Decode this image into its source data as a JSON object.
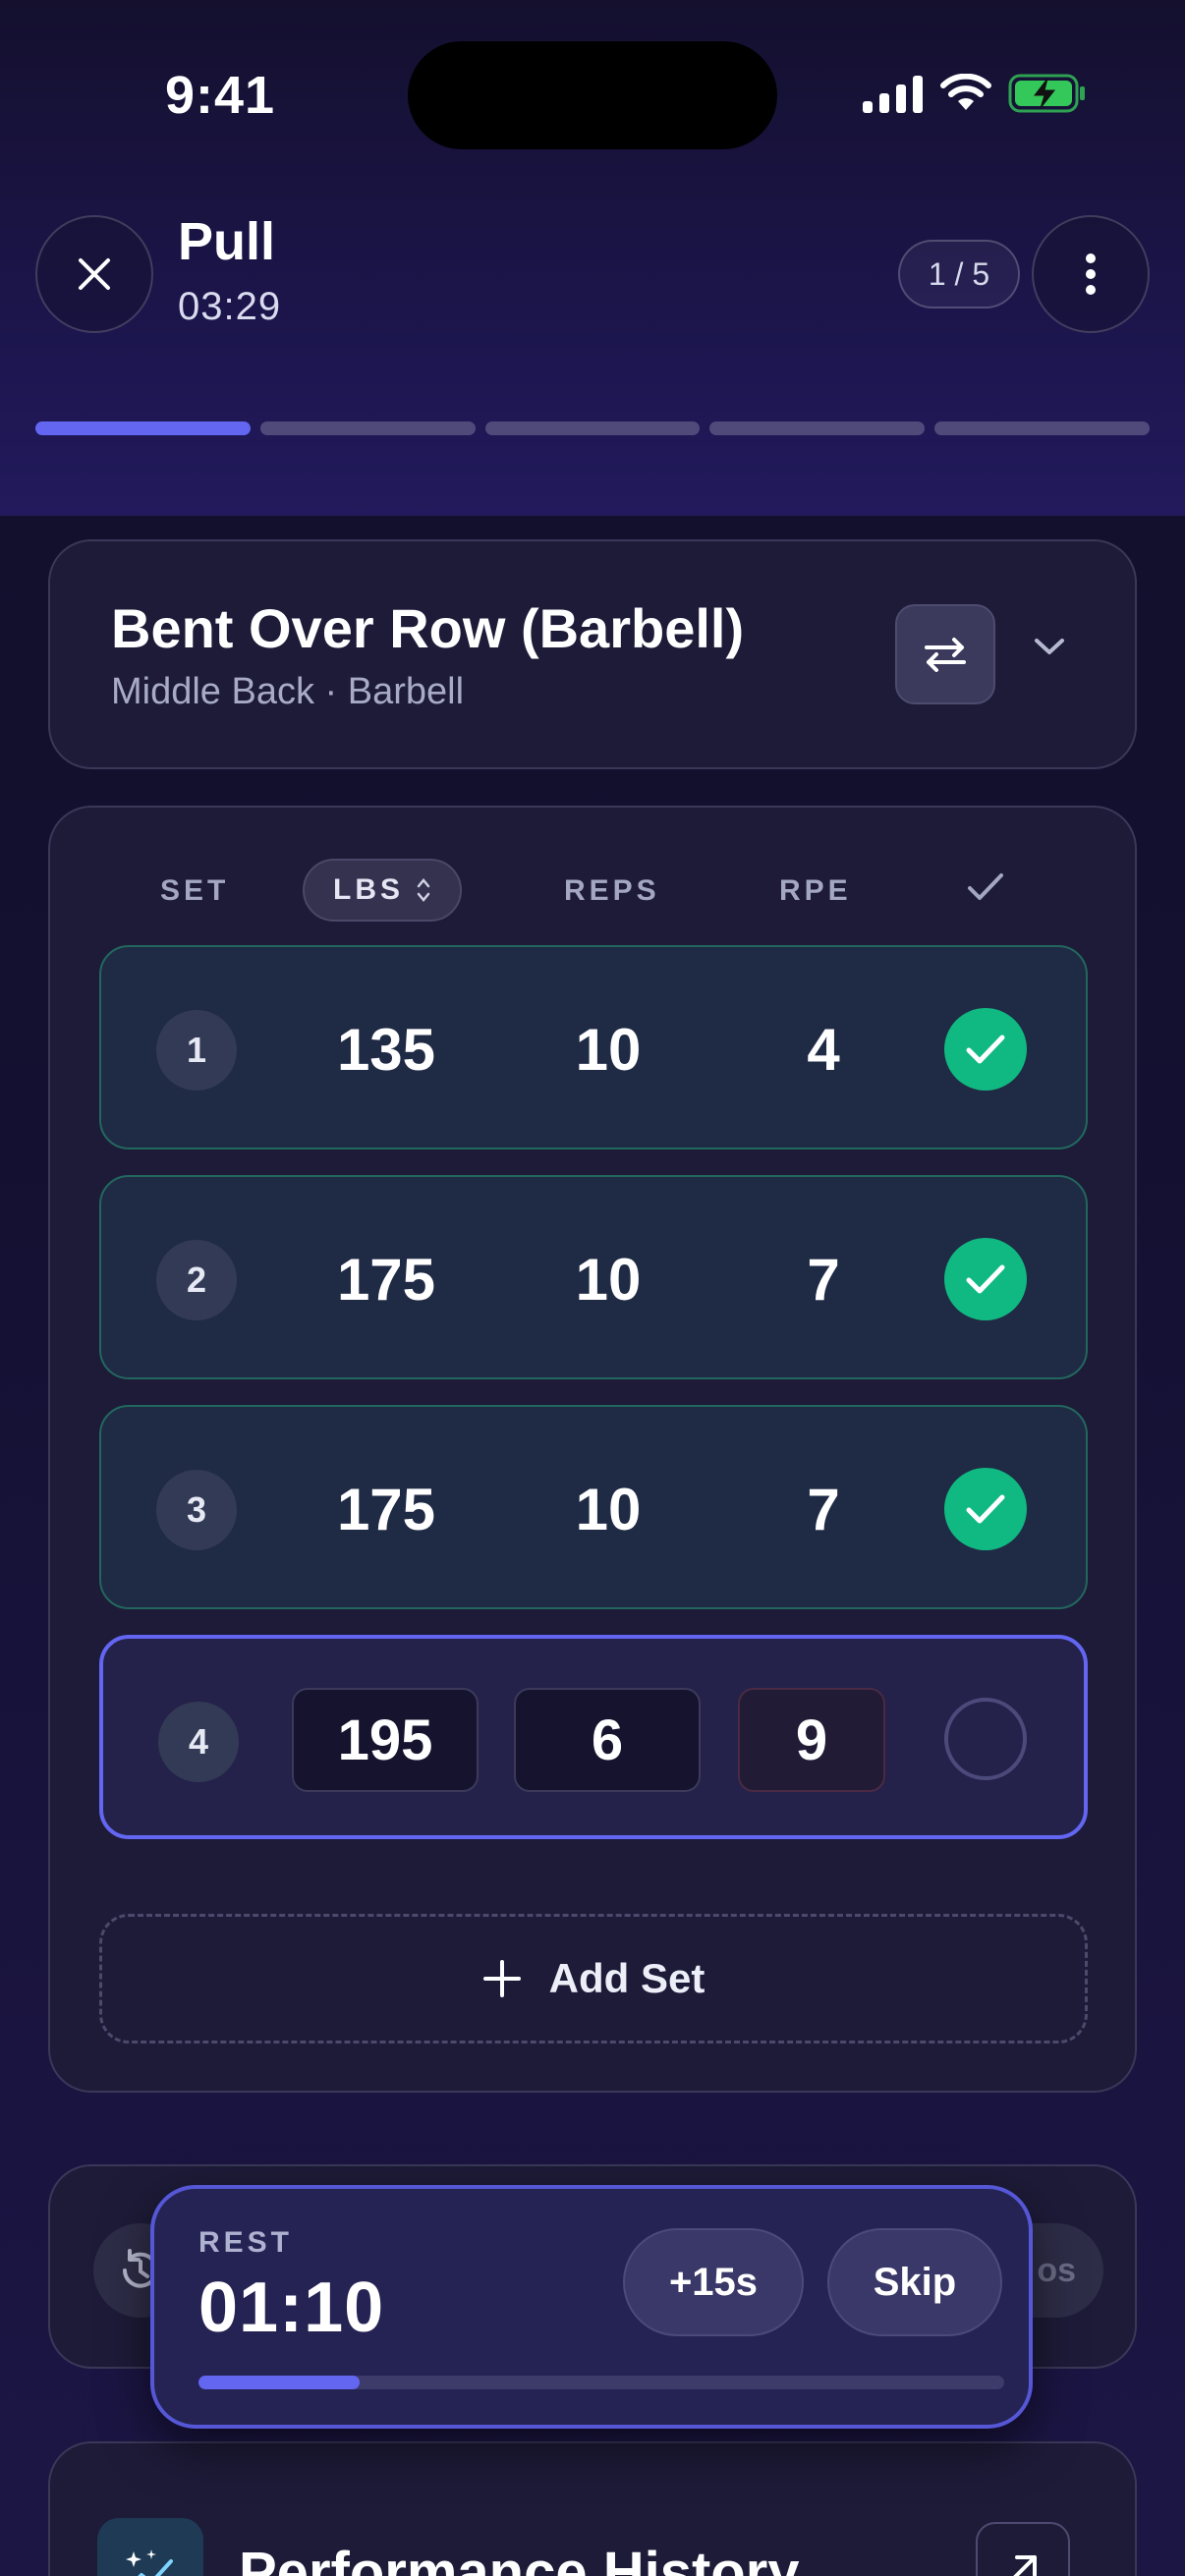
{
  "status_bar": {
    "time": "9:41"
  },
  "header": {
    "title": "Pull",
    "elapsed": "03:29",
    "exercise_counter": "1 / 5",
    "progress_segments": [
      true,
      false,
      false,
      false,
      false
    ]
  },
  "exercise": {
    "name": "Bent Over Row (Barbell)",
    "meta": "Middle Back · Barbell"
  },
  "sets_table": {
    "columns": {
      "set": "SET",
      "weight_unit": "LBS",
      "reps": "REPS",
      "rpe": "RPE"
    },
    "rows": [
      {
        "set": "1",
        "weight": "135",
        "reps": "10",
        "rpe": "4",
        "completed": true
      },
      {
        "set": "2",
        "weight": "175",
        "reps": "10",
        "rpe": "7",
        "completed": true
      },
      {
        "set": "3",
        "weight": "175",
        "reps": "10",
        "rpe": "7",
        "completed": true
      }
    ],
    "current_row": {
      "set": "4",
      "weight": "195",
      "reps": "6",
      "rpe": "9",
      "completed": false
    },
    "add_set_label": "Add Set"
  },
  "notes_row": {
    "pill_text": "os"
  },
  "rest_timer": {
    "label": "REST",
    "time": "01:10",
    "add_time_label": "+15s",
    "skip_label": "Skip",
    "progress": 0.2
  },
  "performance": {
    "title": "Performance History"
  },
  "colors": {
    "accent": "#6366f1",
    "success": "#10b981",
    "card_bg": "#1d1b38",
    "completed_row_bg": "#1f2a45"
  }
}
